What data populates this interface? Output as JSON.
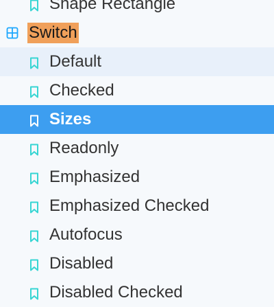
{
  "sidebar": {
    "previous_item": {
      "label": "Shape Rectangle",
      "icon": "bookmark-icon"
    },
    "group": {
      "label": "Switch",
      "icon": "component-grid-icon"
    },
    "items": [
      {
        "label": "Default",
        "icon": "bookmark-icon",
        "state": "hover"
      },
      {
        "label": "Checked",
        "icon": "bookmark-icon",
        "state": ""
      },
      {
        "label": "Sizes",
        "icon": "bookmark-icon",
        "state": "selected"
      },
      {
        "label": "Readonly",
        "icon": "bookmark-icon",
        "state": ""
      },
      {
        "label": "Emphasized",
        "icon": "bookmark-icon",
        "state": ""
      },
      {
        "label": "Emphasized Checked",
        "icon": "bookmark-icon",
        "state": ""
      },
      {
        "label": "Autofocus",
        "icon": "bookmark-icon",
        "state": ""
      },
      {
        "label": "Disabled",
        "icon": "bookmark-icon",
        "state": ""
      },
      {
        "label": "Disabled Checked",
        "icon": "bookmark-icon",
        "state": ""
      }
    ]
  },
  "colors": {
    "background": "#f6f9fc",
    "hover": "#e8f0fa",
    "selected": "#3d9ef0",
    "search_highlight": "#f0a05a",
    "bookmark_icon": "#37d5d3",
    "component_icon": "#1ea7fd"
  }
}
